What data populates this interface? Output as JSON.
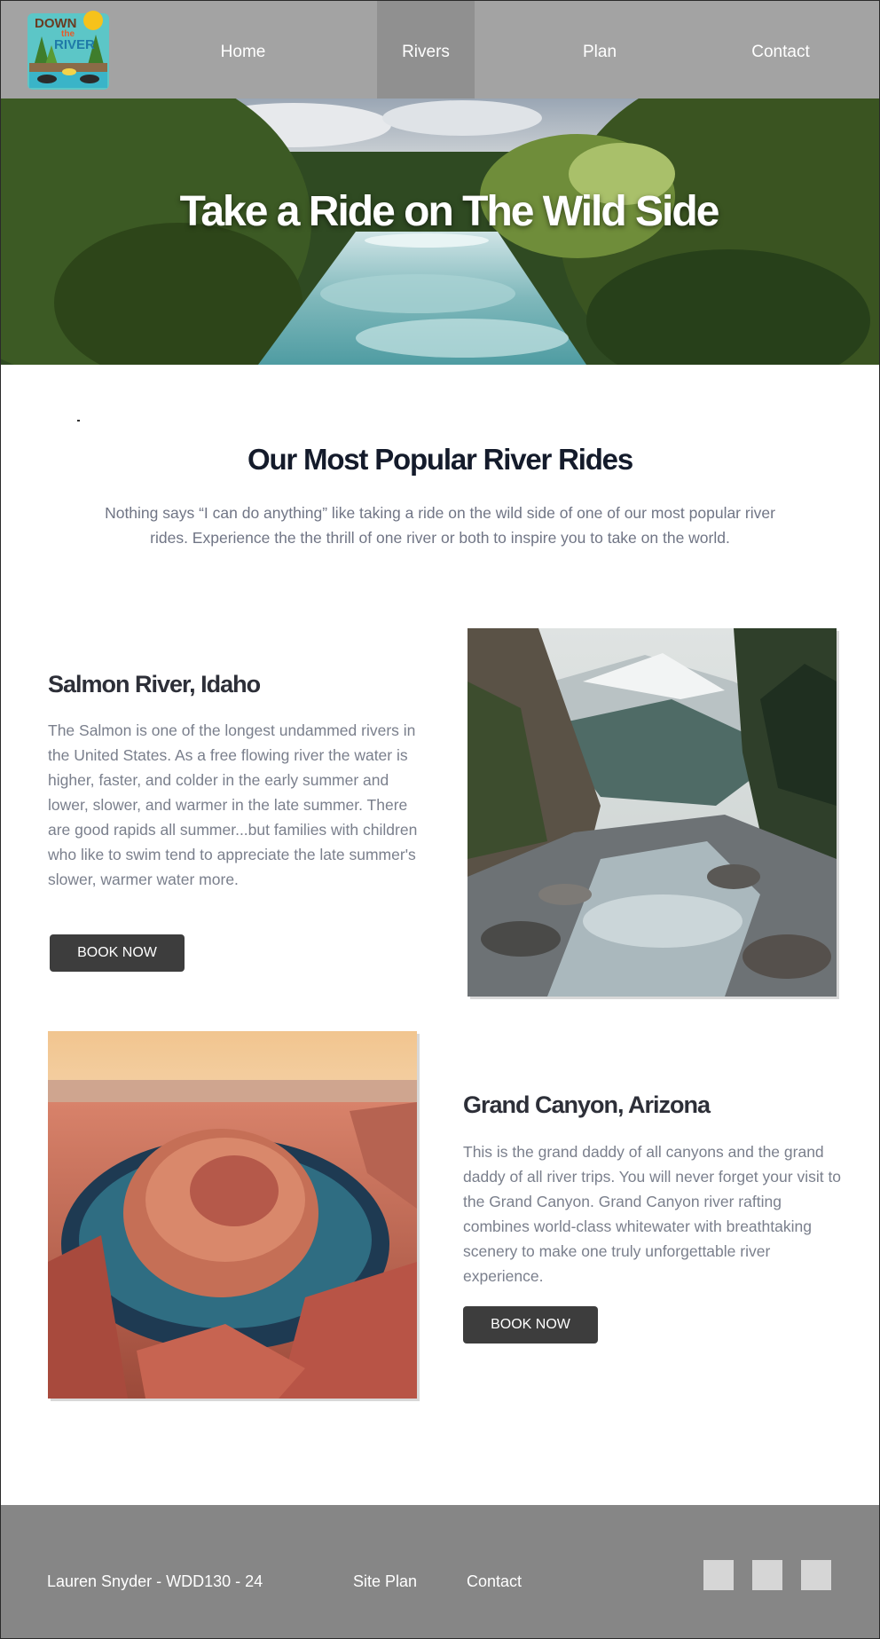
{
  "nav": {
    "logo": {
      "line1": "DOWN",
      "line2": "the",
      "line3": "RIVER"
    },
    "items": [
      {
        "label": "Home"
      },
      {
        "label": "Rivers",
        "active": true
      },
      {
        "label": "Plan"
      },
      {
        "label": "Contact"
      }
    ]
  },
  "hero": {
    "title": "Take a Ride on The Wild Side"
  },
  "intro": {
    "title": "Our Most Popular River Rides",
    "text": "Nothing says “I can do anything” like taking a ride on the wild side of one of our most popular river rides. Experience the the thrill of one river or both to inspire you to take on the world."
  },
  "rivers": [
    {
      "title": "Salmon River, Idaho",
      "text": "The Salmon is one of the longest undammed rivers in the United States. As a free flowing river the water is higher, faster, and colder in the early summer and lower, slower, and warmer in the late summer. There are good rapids all summer...but families with children who like to swim tend to appreciate the late summer's slower, warmer water more.",
      "button": "BOOK NOW"
    },
    {
      "title": "Grand Canyon, Arizona",
      "text": "This is the grand daddy of all canyons and the grand daddy of all river trips. You will never forget your visit to the Grand Canyon. Grand Canyon river rafting combines world-class whitewater with breathtaking scenery to make one truly unforgettable river experience.",
      "button": "BOOK NOW"
    }
  ],
  "footer": {
    "credit": "Lauren Snyder - WDD130 - 24",
    "links": [
      {
        "label": "Site Plan"
      },
      {
        "label": "Contact"
      }
    ],
    "social_icons": [
      "social-icon",
      "social-icon",
      "social-icon"
    ]
  },
  "colors": {
    "nav_bg": "#a3a3a3",
    "nav_active": "#909090",
    "footer_bg": "#868686",
    "button_bg": "#3d3d3d",
    "heading": "#141b2b",
    "body_text": "#7a7f8c"
  }
}
